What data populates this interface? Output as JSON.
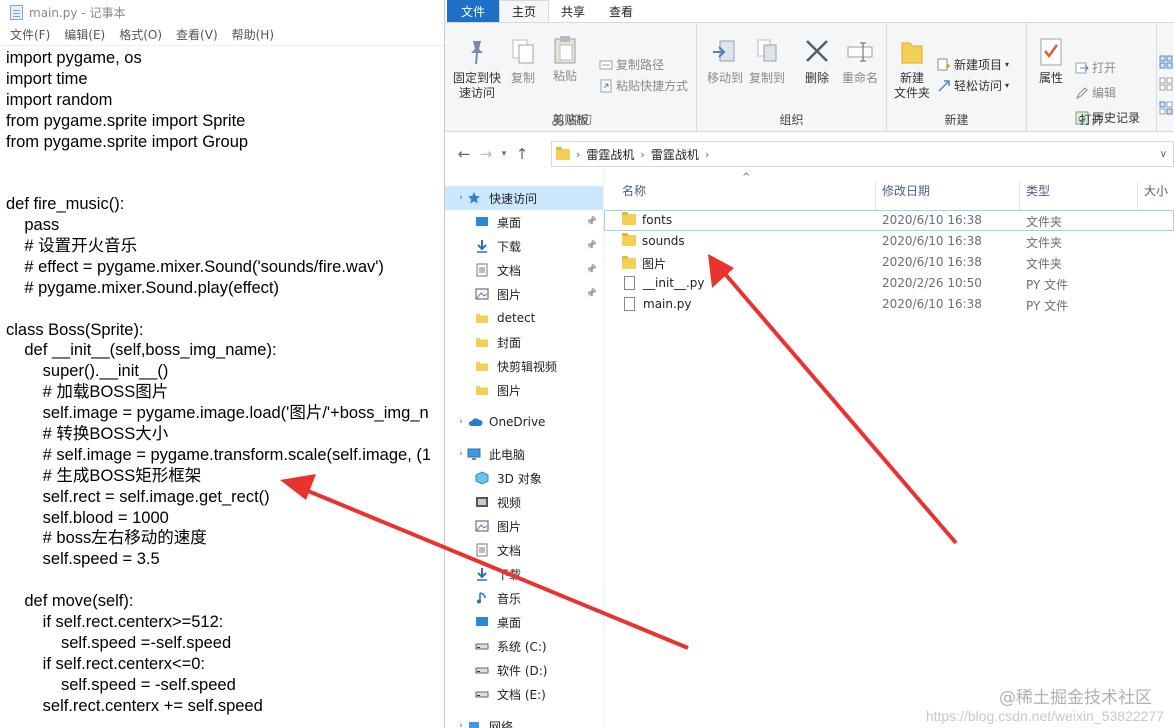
{
  "notepad": {
    "title": "main.py - 记事本",
    "menu": [
      "文件(F)",
      "编辑(E)",
      "格式(O)",
      "查看(V)",
      "帮助(H)"
    ],
    "code_lines": [
      "import pygame, os",
      "import time",
      "import random",
      "from pygame.sprite import Sprite",
      "from pygame.sprite import Group",
      "",
      "",
      "def fire_music():",
      "    pass",
      "    # 设置开火音乐",
      "    # effect = pygame.mixer.Sound('sounds/fire.wav')",
      "    # pygame.mixer.Sound.play(effect)",
      "",
      "class Boss(Sprite):",
      "    def __init__(self,boss_img_name):",
      "        super().__init__()",
      "        # 加载BOSS图片",
      "        self.image = pygame.image.load('图片/'+boss_img_n",
      "        # 转换BOSS大小",
      "        # self.image = pygame.transform.scale(self.image, (1",
      "        # 生成BOSS矩形框架",
      "        self.rect = self.image.get_rect()",
      "        self.blood = 1000",
      "        # boss左右移动的速度",
      "        self.speed = 3.5",
      "",
      "    def move(self):",
      "        if self.rect.centerx>=512:",
      "            self.speed =-self.speed",
      "        if self.rect.centerx<=0:",
      "            self.speed = -self.speed",
      "        self.rect.centerx += self.speed"
    ]
  },
  "explorer": {
    "tabs": [
      "文件",
      "主页",
      "共享",
      "查看"
    ],
    "ribbon": {
      "pin": "固定到快\n速访问",
      "copy": "复制",
      "paste": "粘贴",
      "copy_path": "复制路径",
      "paste_shortcut": "粘贴快捷方式",
      "cut": "剪切",
      "clipboard": "剪贴板",
      "move_to": "移动到",
      "copy_to": "复制到",
      "delete": "删除",
      "rename": "重命名",
      "organize": "组织",
      "new_folder": "新建\n文件夹",
      "new_item": "新建项目",
      "easy_access": "轻松访问",
      "new": "新建",
      "properties": "属性",
      "open": "打开",
      "edit": "编辑",
      "history": "历史记录",
      "open_group": "打开"
    },
    "breadcrumbs": [
      "雷霆战机",
      "雷霆战机"
    ],
    "nav_items": [
      {
        "label": "快速访问",
        "icon": "star-icon",
        "selected": true,
        "chev": true
      },
      {
        "label": "桌面",
        "icon": "desktop-icon",
        "pinned": true
      },
      {
        "label": "下载",
        "icon": "download-icon",
        "pinned": true
      },
      {
        "label": "文档",
        "icon": "document-icon",
        "pinned": true
      },
      {
        "label": "图片",
        "icon": "pictures-icon",
        "pinned": true
      },
      {
        "label": "detect",
        "icon": "folder-icon"
      },
      {
        "label": "封面",
        "icon": "folder-icon"
      },
      {
        "label": "快剪辑视频",
        "icon": "folder-icon"
      },
      {
        "label": "图片",
        "icon": "folder-icon"
      },
      {
        "label": "OneDrive",
        "icon": "cloud-icon",
        "chev": true,
        "gap": true
      },
      {
        "label": "此电脑",
        "icon": "pc-icon",
        "chev": true,
        "gap": true
      },
      {
        "label": "3D 对象",
        "icon": "cube-icon"
      },
      {
        "label": "视频",
        "icon": "video-icon"
      },
      {
        "label": "图片",
        "icon": "pictures-icon"
      },
      {
        "label": "文档",
        "icon": "document-icon"
      },
      {
        "label": "下载",
        "icon": "download-icon"
      },
      {
        "label": "音乐",
        "icon": "music-icon"
      },
      {
        "label": "桌面",
        "icon": "desktop-icon"
      },
      {
        "label": "系统 (C:)",
        "icon": "drive-icon"
      },
      {
        "label": "软件 (D:)",
        "icon": "drive-icon"
      },
      {
        "label": "文档 (E:)",
        "icon": "drive-icon"
      },
      {
        "label": "网络",
        "icon": "network-icon",
        "chev": true,
        "gap": true
      }
    ],
    "columns": [
      "名称",
      "修改日期",
      "类型",
      "大小"
    ],
    "files": [
      {
        "name": "fonts",
        "date": "2020/6/10 16:38",
        "type": "文件夹",
        "kind": "folder"
      },
      {
        "name": "sounds",
        "date": "2020/6/10 16:38",
        "type": "文件夹",
        "kind": "folder"
      },
      {
        "name": "图片",
        "date": "2020/6/10 16:38",
        "type": "文件夹",
        "kind": "folder"
      },
      {
        "name": "__init__.py",
        "date": "2020/2/26 10:50",
        "type": "PY 文件",
        "kind": "file"
      },
      {
        "name": "main.py",
        "date": "2020/6/10 16:38",
        "type": "PY 文件",
        "kind": "file"
      }
    ]
  },
  "watermark": "@稀土掘金技术社区",
  "watermark_url": "https://blog.csdn.net/weixin_53822277",
  "colors": {
    "accent": "#1e70c6",
    "arrow": "#e8332e",
    "selected": "#cce8ff"
  }
}
